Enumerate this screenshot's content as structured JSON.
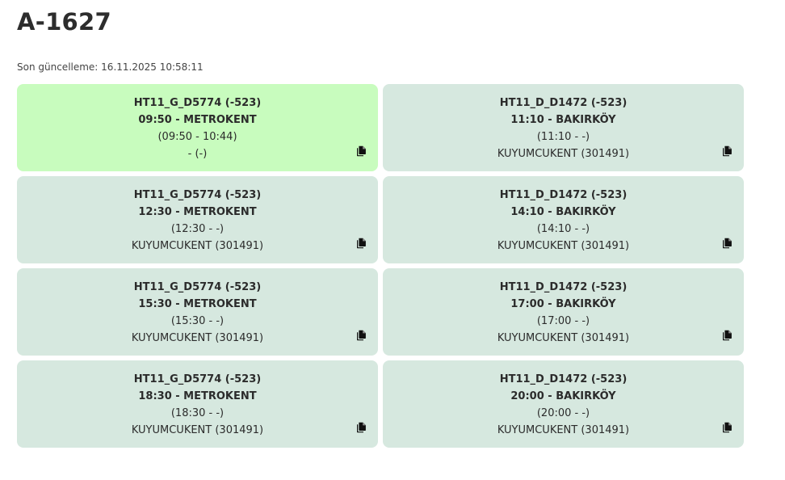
{
  "page": {
    "title": "A-1627",
    "last_update": "Son güncelleme: 16.11.2025 10:58:11"
  },
  "cards": [
    {
      "line1": "HT11_G_D5774 (-523)",
      "line2": "09:50 - METROKENT",
      "line3": "(09:50 - 10:44)",
      "line4": "- (-)",
      "active": true,
      "icon": "copy-icon"
    },
    {
      "line1": "HT11_D_D1472 (-523)",
      "line2": "11:10 - BAKIRKÖY",
      "line3": "(11:10 - -)",
      "line4": "KUYUMCUKENT (301491)",
      "active": false,
      "icon": "copy-icon"
    },
    {
      "line1": "HT11_G_D5774 (-523)",
      "line2": "12:30 - METROKENT",
      "line3": "(12:30 - -)",
      "line4": "KUYUMCUKENT (301491)",
      "active": false,
      "icon": "copy-icon"
    },
    {
      "line1": "HT11_D_D1472 (-523)",
      "line2": "14:10 - BAKIRKÖY",
      "line3": "(14:10 - -)",
      "line4": "KUYUMCUKENT (301491)",
      "active": false,
      "icon": "copy-icon"
    },
    {
      "line1": "HT11_G_D5774 (-523)",
      "line2": "15:30 - METROKENT",
      "line3": "(15:30 - -)",
      "line4": "KUYUMCUKENT (301491)",
      "active": false,
      "icon": "copy-icon"
    },
    {
      "line1": "HT11_D_D1472 (-523)",
      "line2": "17:00 - BAKIRKÖY",
      "line3": "(17:00 - -)",
      "line4": "KUYUMCUKENT (301491)",
      "active": false,
      "icon": "copy-icon"
    },
    {
      "line1": "HT11_G_D5774 (-523)",
      "line2": "18:30 - METROKENT",
      "line3": "(18:30 - -)",
      "line4": "KUYUMCUKENT (301491)",
      "active": false,
      "icon": "copy-icon"
    },
    {
      "line1": "HT11_D_D1472 (-523)",
      "line2": "20:00 - BAKIRKÖY",
      "line3": "(20:00 - -)",
      "line4": "KUYUMCUKENT (301491)",
      "active": false,
      "icon": "copy-icon"
    }
  ],
  "colors": {
    "card_default": "#d6e8df",
    "card_active": "#c8fcbe",
    "text": "#2b2b2b"
  }
}
